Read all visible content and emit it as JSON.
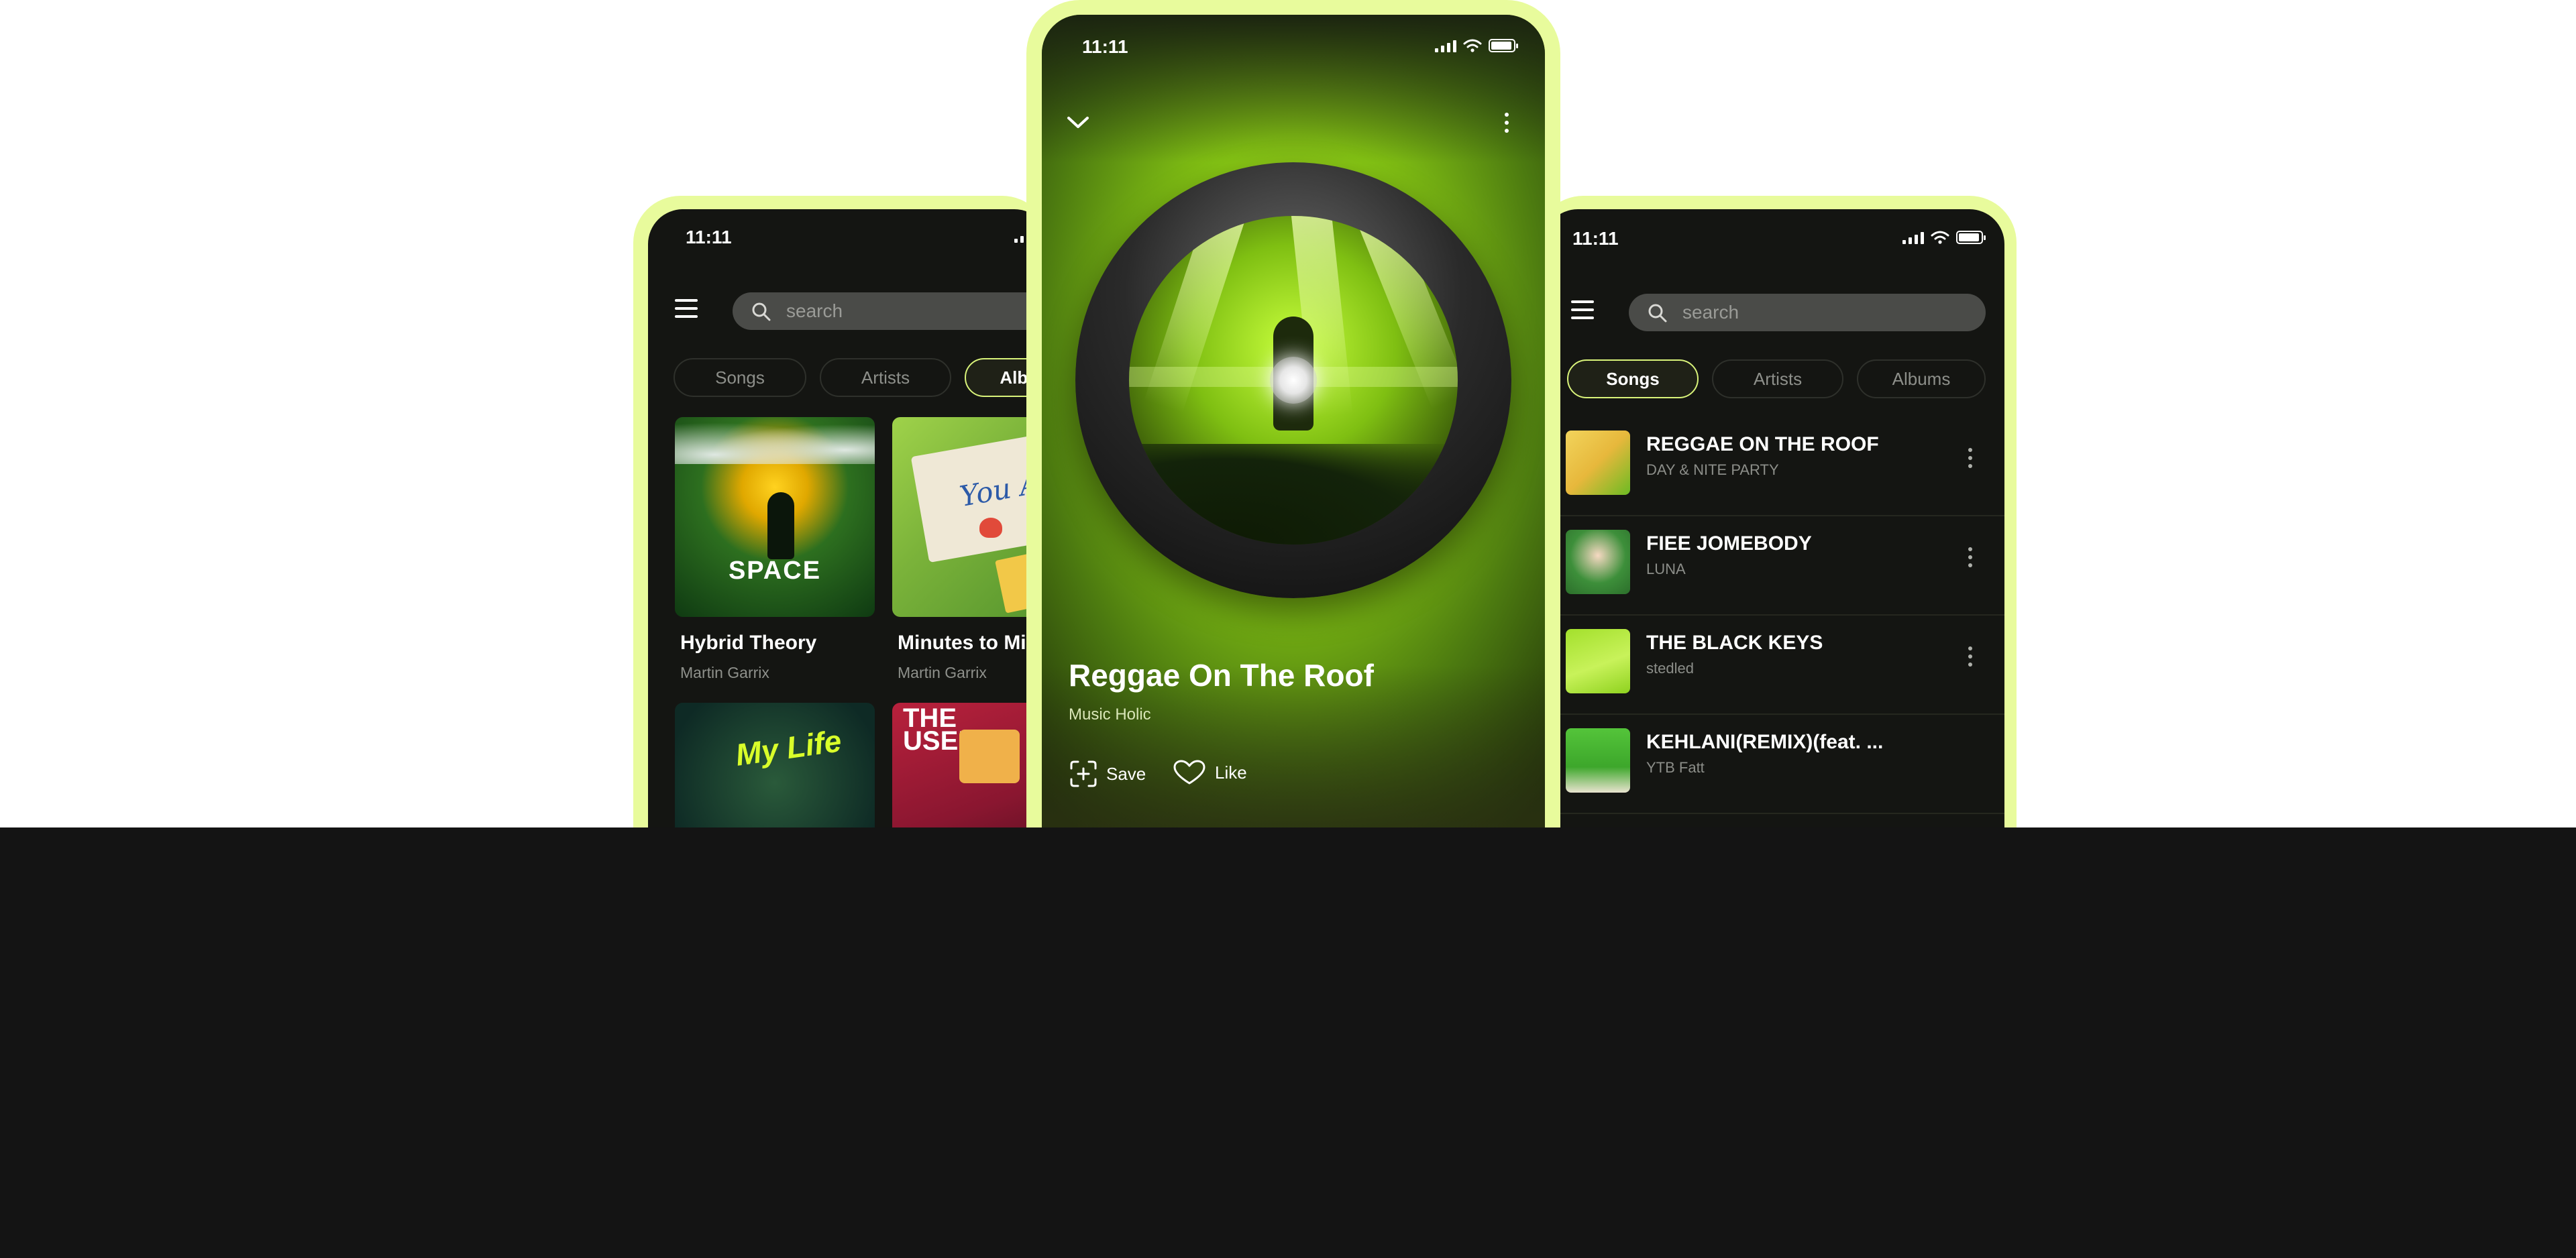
{
  "status_bar": {
    "time": "11:11"
  },
  "left_screen": {
    "search_placeholder": "search",
    "tabs": [
      "Songs",
      "Artists",
      "Albums"
    ],
    "active_tab": "Albums",
    "albums": [
      {
        "title": "Hybrid Theory",
        "artist": "Martin Garrix",
        "cover_text": "SPACE"
      },
      {
        "title": "Minutes to Midnight",
        "artist": "Martin Garrix",
        "cover_text": "You Are"
      },
      {
        "title": "",
        "artist": "",
        "cover_text": "My Life"
      },
      {
        "title": "",
        "artist": "",
        "cover_text": "THE USED"
      }
    ]
  },
  "center_screen": {
    "song_title": "Reggae On The Roof",
    "artist": "Music Holic",
    "save_label": "Save",
    "like_label": "Like",
    "accent_color": "#b2e528"
  },
  "right_screen": {
    "search_placeholder": "search",
    "tabs": [
      "Songs",
      "Artists",
      "Albums"
    ],
    "active_tab": "Songs",
    "songs": [
      {
        "title": "REGGAE ON THE ROOF",
        "artist": "DAY & NITE PARTY"
      },
      {
        "title": "FIEE JOMEBODY",
        "artist": "LUNA"
      },
      {
        "title": "THE BLACK KEYS",
        "artist": "stedled"
      },
      {
        "title": "KEHLANI(REMIX)(feat. ...",
        "artist": "YTB Fatt"
      }
    ]
  },
  "colors": {
    "frame": "#e8fb9c",
    "screen_bg": "#141512",
    "active_chip_border": "#d9f37a"
  }
}
